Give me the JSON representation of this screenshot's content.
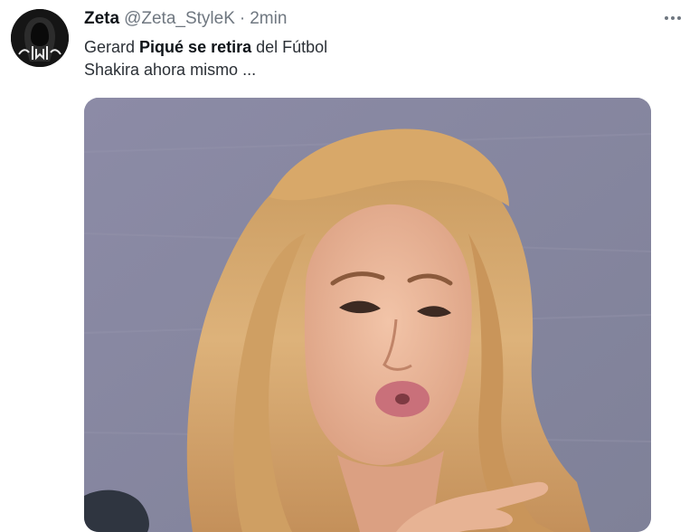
{
  "tweet": {
    "display_name": "Zeta",
    "handle": "@Zeta_StyleK",
    "separator": "·",
    "time": "2min",
    "text_line1": {
      "part1": "Gerard",
      "part2": "Piqué se retira",
      "part3": "del Fútbol"
    },
    "text_line2": "Shakira ahora mismo ...",
    "avatar_icon": "hooded-figure-icon",
    "more_icon": "more-horizontal-icon",
    "media": {
      "kind": "photo"
    }
  },
  "colors": {
    "text_primary": "#0f1419",
    "text_secondary": "#6f7780",
    "photo_background": "#8d8ea6",
    "hair": "#d2a46a"
  }
}
